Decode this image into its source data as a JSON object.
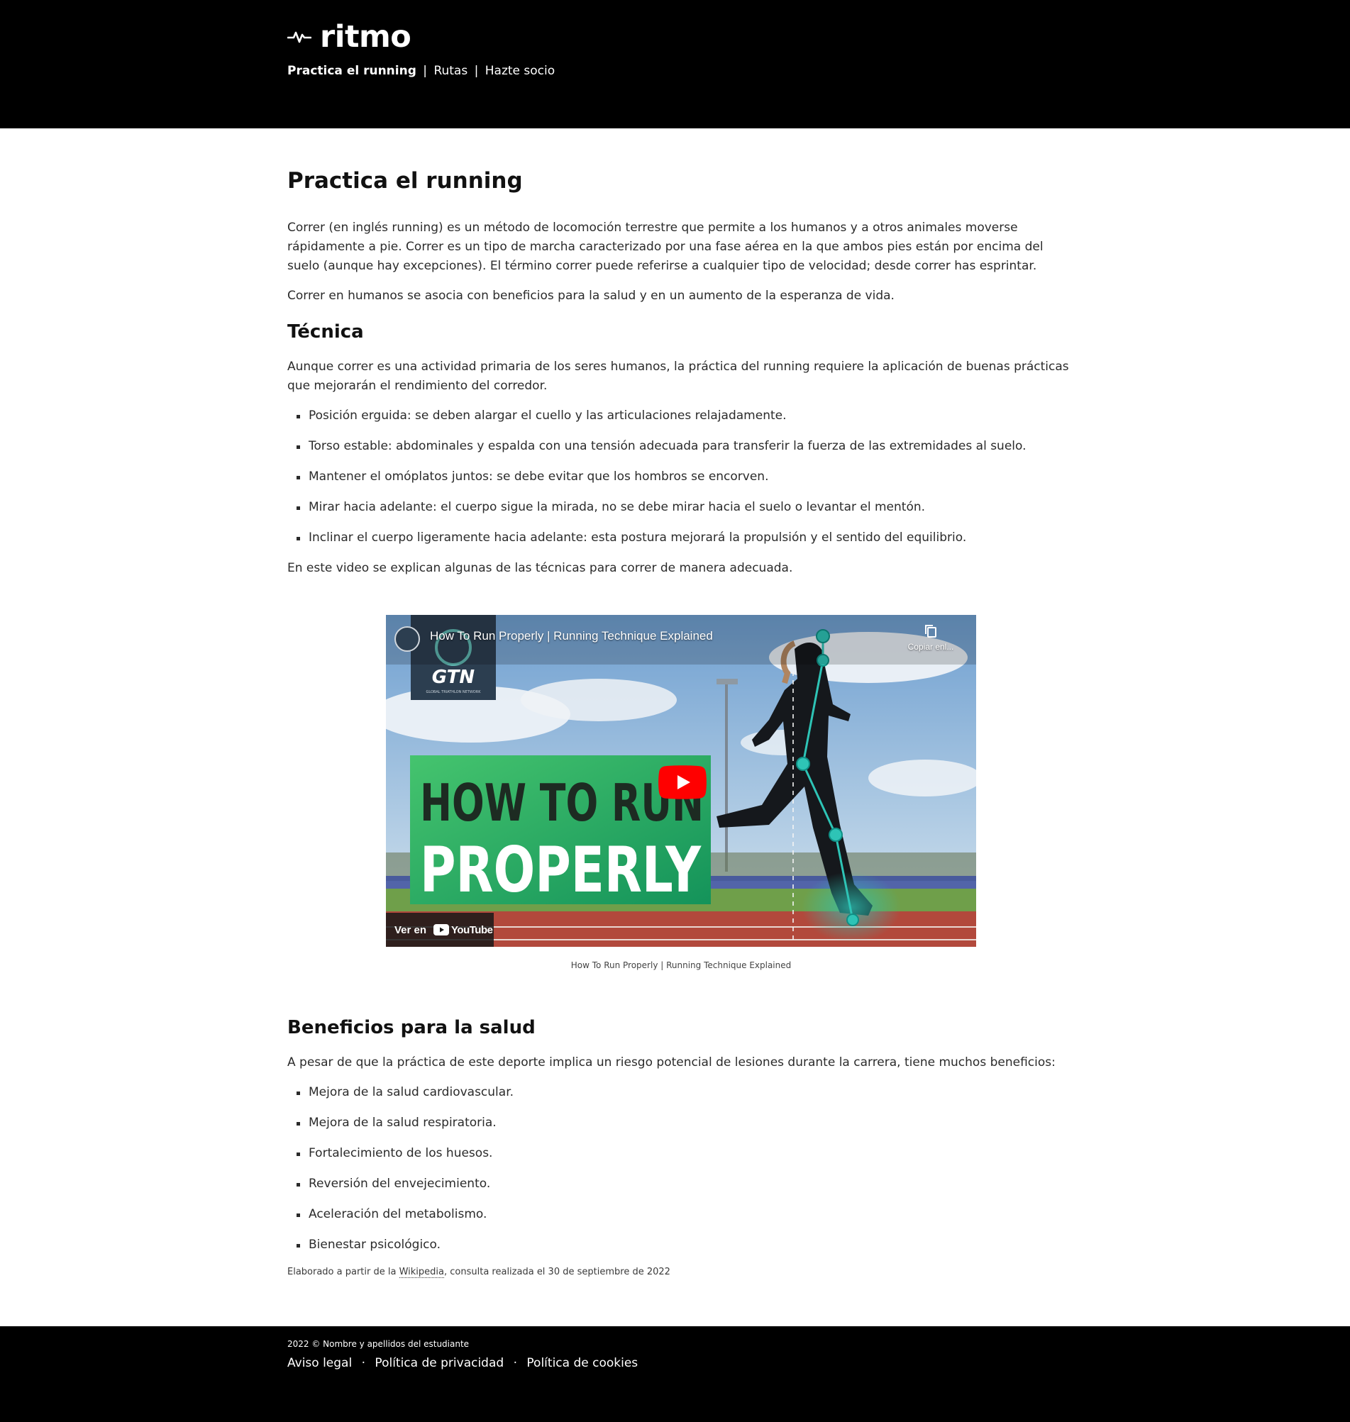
{
  "header": {
    "brand": "ritmo",
    "logo_icon": "pulse-icon",
    "nav": [
      {
        "label": "Practica el running",
        "active": true
      },
      {
        "label": "Rutas",
        "active": false
      },
      {
        "label": "Hazte socio",
        "active": false
      }
    ],
    "nav_separator": "|"
  },
  "main": {
    "title": "Practica el running",
    "intro_paragraphs": [
      "Correr (en inglés running) es un método de locomoción terrestre que permite a los humanos y a otros animales moverse rápidamente a pie. Correr es un tipo de marcha caracterizado por una fase aérea en la que ambos pies están por encima del suelo (aunque hay excepciones). El término correr puede referirse a cualquier tipo de velocidad; desde correr has esprintar.",
      "Correr en humanos se asocia con beneficios para la salud y en un aumento de la esperanza de vida."
    ],
    "tecnica": {
      "heading": "Técnica",
      "intro": "Aunque correr es una actividad primaria de los seres humanos, la práctica del running requiere la aplicación de buenas prácticas que mejorarán el rendimiento del corredor.",
      "items": [
        "Posición erguida: se deben alargar el cuello y las articulaciones relajadamente.",
        "Torso estable: abdominales y espalda con una tensión adecuada para transferir la fuerza de las extremidades al suelo.",
        "Mantener el omóplatos juntos: se debe evitar que los hombros se encorven.",
        "Mirar hacia adelante: el cuerpo sigue la mirada, no se debe mirar hacia el suelo o levantar el mentón.",
        "Inclinar el cuerpo ligeramente hacia adelante: esta postura mejorará la propulsión y el sentido del equilibrio."
      ],
      "video_intro": "En este video se explican algunas de las técnicas para correr de manera adecuada."
    },
    "video": {
      "title": "How To Run Properly | Running Technique Explained",
      "copy_label": "Copiar enl...",
      "thumbnail_line1": "HOW TO RUN",
      "thumbnail_line2": "PROPERLY",
      "channel_logo": "GTN",
      "channel_tagline": "GLOBAL TRIATHLON NETWORK",
      "watch_on": "Ver en",
      "youtube_label": "YouTube",
      "caption": "How To Run Properly | Running Technique Explained",
      "colors": {
        "play": "#ff0000",
        "thumb_green": "#1ea45a",
        "accent": "#2ec4b6"
      }
    },
    "beneficios": {
      "heading": "Beneficios para la salud",
      "intro": "A pesar de que la práctica de este deporte implica un riesgo potencial de lesiones durante la carrera, tiene muchos beneficios:",
      "items": [
        "Mejora de la salud cardiovascular.",
        "Mejora de la salud respiratoria.",
        "Fortalecimiento de los huesos.",
        "Reversión del envejecimiento.",
        "Aceleración del metabolismo.",
        "Bienestar psicológico."
      ]
    },
    "source": {
      "prefix": "Elaborado a partir de la ",
      "link": "Wikipedia",
      "suffix": ", consulta realizada el 30 de septiembre de 2022"
    }
  },
  "footer": {
    "copyright": "2022 © Nombre y apellidos del estudiante",
    "links": [
      "Aviso legal",
      "Política de privacidad",
      "Política de cookies"
    ],
    "separator": "·"
  }
}
